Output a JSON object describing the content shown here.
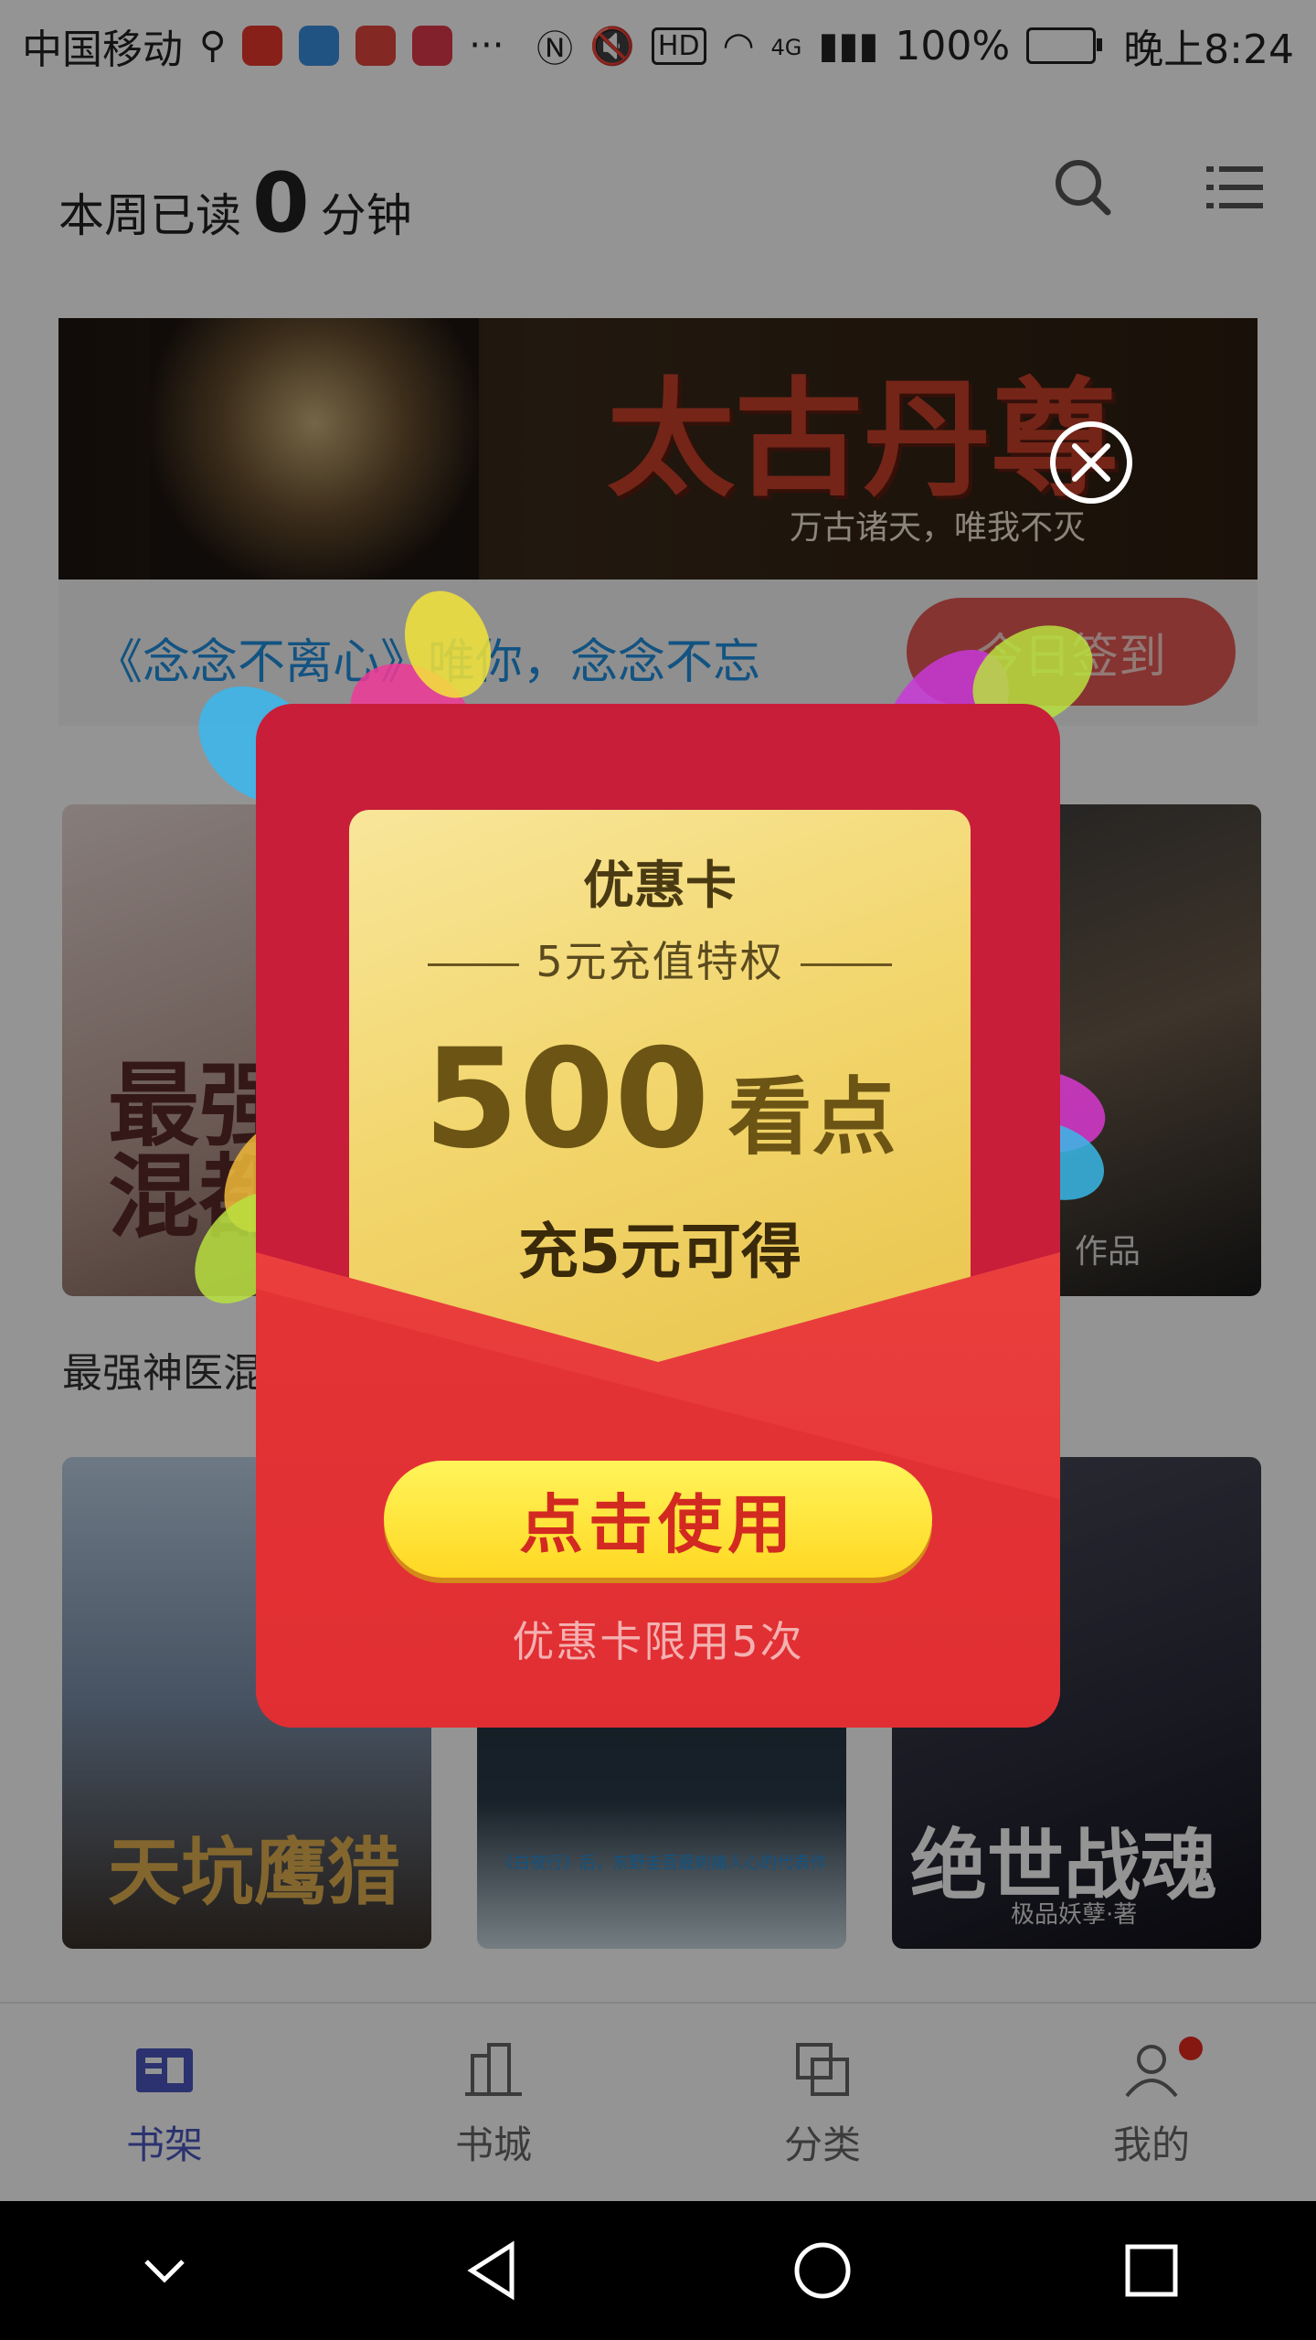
{
  "status_bar": {
    "carrier": "中国移动",
    "battery": "100%",
    "network": "4G",
    "time": "晚上8:24"
  },
  "header": {
    "weekly_prefix": "本周已读",
    "weekly_value": "0",
    "weekly_suffix": "分钟"
  },
  "banner": {
    "title": "太古丹尊",
    "subtitle": "万古诸天，唯我不灭"
  },
  "notice": {
    "text": "《念念不离心》唯你，念念不忘",
    "sign_in_label": "今日签到"
  },
  "books": [
    {
      "title": "最强神医混都市",
      "cover_text": "最强\n混都"
    },
    {
      "title": "",
      "cover_text": ""
    },
    {
      "title": "",
      "cover_text": "作品"
    },
    {
      "title": "天坑鹰猎",
      "cover_text": "天坑鹰猎"
    },
    {
      "title": "白夜行",
      "cover_text": "《白夜行》后，东野圭吾最刺痛人心的代表作"
    },
    {
      "title": "绝世战魂",
      "cover_text": "绝世战魂",
      "author": "极品妖孽·著"
    }
  ],
  "popup": {
    "card_title": "优惠卡",
    "card_subtitle": "5元充值特权",
    "amount": "500",
    "amount_unit": "看点",
    "condition": "充5元可得",
    "use_button": "点击使用",
    "limit": "优惠卡限用5次"
  },
  "tabs": [
    {
      "label": "书架",
      "active": true
    },
    {
      "label": "书城",
      "active": false
    },
    {
      "label": "分类",
      "active": false
    },
    {
      "label": "我的",
      "active": false
    }
  ],
  "colors": {
    "accent": "#4a57c0",
    "card_red": "#c81e3a",
    "button_yellow": "#ffe23a",
    "notice_blue": "#1f8fe0"
  }
}
